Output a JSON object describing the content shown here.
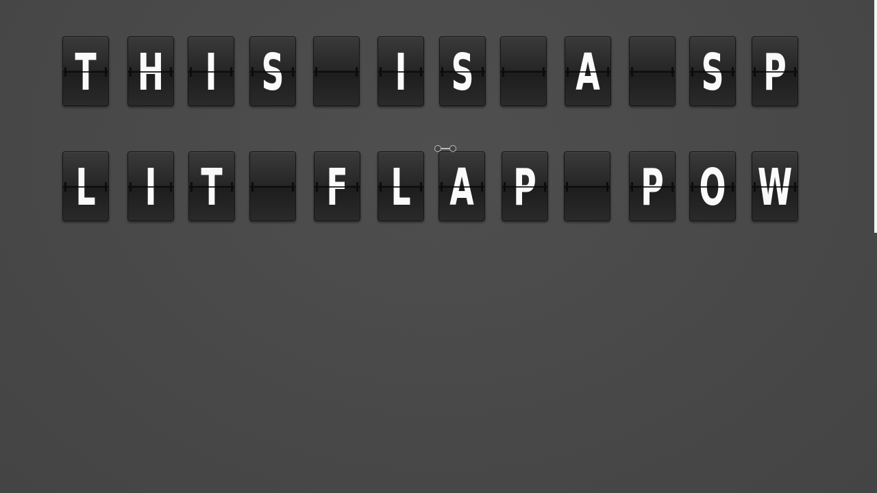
{
  "board": {
    "row1": [
      "T",
      "H",
      "I",
      "S",
      "",
      "I",
      "S",
      "",
      "A",
      "",
      "S",
      "P"
    ],
    "row2": [
      "L",
      "I",
      "T",
      "",
      "F",
      "L",
      "A",
      "P",
      "",
      "P",
      "O",
      "W"
    ]
  },
  "colors": {
    "background": "#4a4a4a",
    "tile": "#262626",
    "letter": "#fafafa"
  },
  "icons": {
    "cursor": "move-handle-icon"
  }
}
